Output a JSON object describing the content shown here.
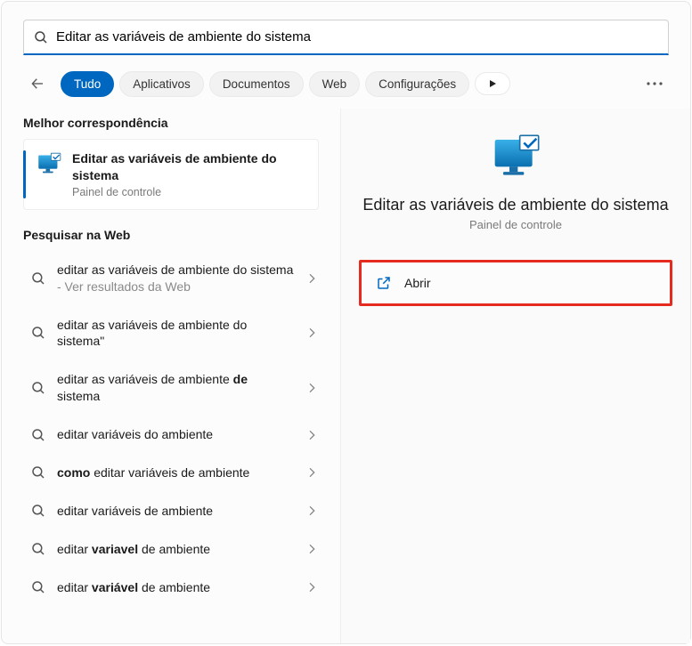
{
  "search": {
    "query": "Editar as variáveis de ambiente do sistema"
  },
  "filters": {
    "tudo": "Tudo",
    "aplicativos": "Aplicativos",
    "documentos": "Documentos",
    "web": "Web",
    "configuracoes": "Configurações"
  },
  "sections": {
    "best_match_heading": "Melhor correspondência",
    "web_heading": "Pesquisar na Web"
  },
  "best_match": {
    "title": "Editar as variáveis de ambiente do sistema",
    "subtitle": "Painel de controle"
  },
  "web_results": [
    {
      "pre": "editar as variáveis de ambiente do sistema",
      "suffix": " - Ver resultados da Web"
    },
    {
      "pre": "editar as variáveis de ambiente do sistema\""
    },
    {
      "html": "editar as variáveis de ambiente <b>de</b> sistema"
    },
    {
      "pre": "editar variáveis do ambiente"
    },
    {
      "html": "<b>como</b> editar variáveis de ambiente"
    },
    {
      "pre": "editar variáveis de ambiente"
    },
    {
      "html": "editar <b>variavel</b> de ambiente"
    },
    {
      "html": "editar <b>variável</b> de ambiente"
    }
  ],
  "detail": {
    "title": "Editar as variáveis de ambiente do sistema",
    "subtitle": "Painel de controle",
    "open": "Abrir"
  }
}
